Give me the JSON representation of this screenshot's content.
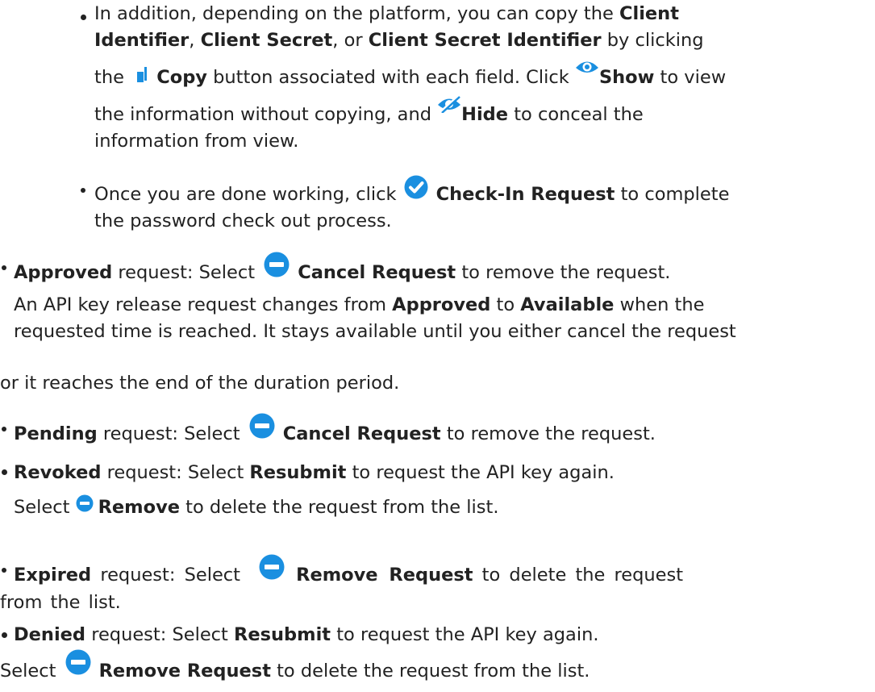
{
  "nested": {
    "item1": {
      "p1_a": "In addition, depending on the platform, you can copy the ",
      "p1_b": "Client",
      "p2_a": "Identifier",
      "p2_b": ", ",
      "p2_c": "Client Secret",
      "p2_d": ", or ",
      "p2_e": "Client Secret Identifier",
      "p2_f": " by clicking",
      "p3_a": "the ",
      "p3_b": "Copy",
      "p3_c": " button associated with each field. Click ",
      "p3_d": "Show",
      "p3_e": " to view",
      "p4_a": "the information without copying, and ",
      "p4_b": "Hide",
      "p4_c": " to conceal the",
      "p5": "information from view."
    },
    "item2": {
      "a": "Once you are done working, click ",
      "b": "Check-In Request",
      "c": " to complete",
      "d": "the password check out process."
    }
  },
  "items": {
    "approved": {
      "label": "Approved",
      "text1": " request: Select ",
      "action": "Cancel Request",
      "text2": " to remove the request.",
      "note1_a": "An API key release request changes from ",
      "note1_b": "Approved",
      "note1_c": " to ",
      "note1_d": "Available",
      "note1_e": " when the",
      "note2": "requested time is reached. It stays available until you either cancel the request",
      "note3": "or it reaches the end of the duration period."
    },
    "pending": {
      "label": "Pending",
      "text1": " request: Select ",
      "action": "Cancel Request",
      "text2": " to remove the request."
    },
    "revoked": {
      "label": "Revoked",
      "text1": " request: Select ",
      "action": "Resubmit",
      "text2": " to request the API key again.",
      "sub_a": "Select ",
      "sub_b": "Remove",
      "sub_c": " to delete the request from the list."
    },
    "expired": {
      "label": "Expired",
      "text1": " request: Select ",
      "action": "Remove Request",
      "text2": " to delete the request",
      "line2": "from the list."
    },
    "denied": {
      "label": "Denied",
      "text1": " request: Select ",
      "action": "Resubmit",
      "text2": " to request the API key again.",
      "sub_a": "Select ",
      "sub_b": "Remove Request",
      "sub_c": " to delete the request from the list."
    }
  },
  "icons": {
    "copy": "copy-icon",
    "show": "eye-icon",
    "hide": "eye-slash-icon",
    "checkin": "check-circle-icon",
    "cancel": "minus-circle-icon",
    "remove": "minus-circle-icon"
  },
  "colors": {
    "text": "#222222",
    "icon_blue": "#1a8fe0"
  }
}
